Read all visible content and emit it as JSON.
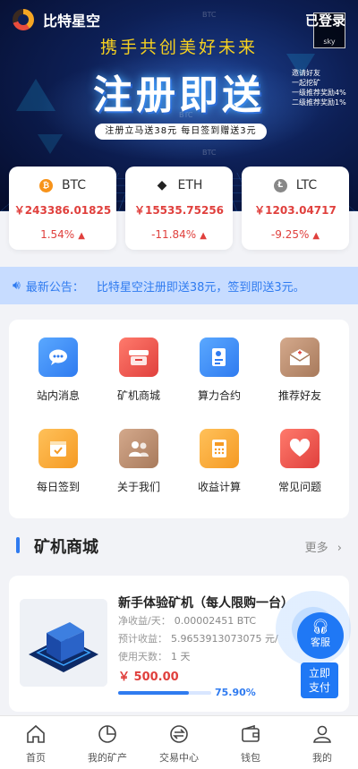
{
  "app": {
    "title": "比特星空",
    "login_label": "已登录"
  },
  "banner": {
    "slogan": "携手共创美好未来",
    "headline": "注册即送",
    "promo": "注册立马送38元 每日签到赠送3元",
    "side_notes": [
      "邀请好友",
      "一起挖矿",
      "一级推荐奖励4%",
      "二级推荐奖励1%"
    ],
    "qr_label": "sky",
    "watermark": "BTC"
  },
  "prices": [
    {
      "name": "BTC",
      "price": "￥243386.01825",
      "change": "1.54%",
      "icon": "bitcoin-icon",
      "color": "#f7931a",
      "glyph": "₿"
    },
    {
      "name": "ETH",
      "price": "￥15535.75256",
      "change": "-11.84%",
      "icon": "ethereum-icon",
      "color": "#222222",
      "glyph": "◆"
    },
    {
      "name": "LTC",
      "price": "￥1203.04717",
      "change": "-9.25%",
      "icon": "litecoin-icon",
      "color": "#888888",
      "glyph": "Ł"
    }
  ],
  "notice": {
    "title": "最新公告：",
    "text": "比特星空注册即送38元，签到即送3元。"
  },
  "menu": [
    {
      "label": "站内消息",
      "icon": "chat-icon",
      "color": "#3b8cf0"
    },
    {
      "label": "矿机商城",
      "icon": "store-icon",
      "color": "#ee5a4c"
    },
    {
      "label": "算力合约",
      "icon": "contract-icon",
      "color": "#3b8cf0"
    },
    {
      "label": "推荐好友",
      "icon": "invite-icon",
      "color": "#b98a6d"
    },
    {
      "label": "每日签到",
      "icon": "checkin-icon",
      "color": "#f5a623"
    },
    {
      "label": "关于我们",
      "icon": "about-icon",
      "color": "#b98a6d"
    },
    {
      "label": "收益计算",
      "icon": "calculator-icon",
      "color": "#f5a623"
    },
    {
      "label": "常见问题",
      "icon": "heart-icon",
      "color": "#ee5a4c"
    }
  ],
  "section": {
    "title": "矿机商城",
    "more": "更多"
  },
  "product": {
    "name": "新手体验矿机（每人限购一台）",
    "net_income_label": "净收益/天：",
    "net_income": "0.00002451 BTC",
    "expected_label": "预计收益：",
    "expected": "5.9653913073075 元/",
    "days_label": "使用天数：",
    "days": "1 天",
    "price": "￥ 500.00",
    "progress": 75.9,
    "progress_text": "75.90%"
  },
  "float": {
    "service_label": "客服",
    "buy_label": "立即\n支付",
    "buy_line1": "立即",
    "buy_line2": "支付"
  },
  "tabs": [
    {
      "label": "首页",
      "icon": "home-icon"
    },
    {
      "label": "我的矿产",
      "icon": "pie-chart-icon"
    },
    {
      "label": "交易中心",
      "icon": "exchange-icon"
    },
    {
      "label": "钱包",
      "icon": "wallet-icon"
    },
    {
      "label": "我的",
      "icon": "user-icon"
    }
  ]
}
